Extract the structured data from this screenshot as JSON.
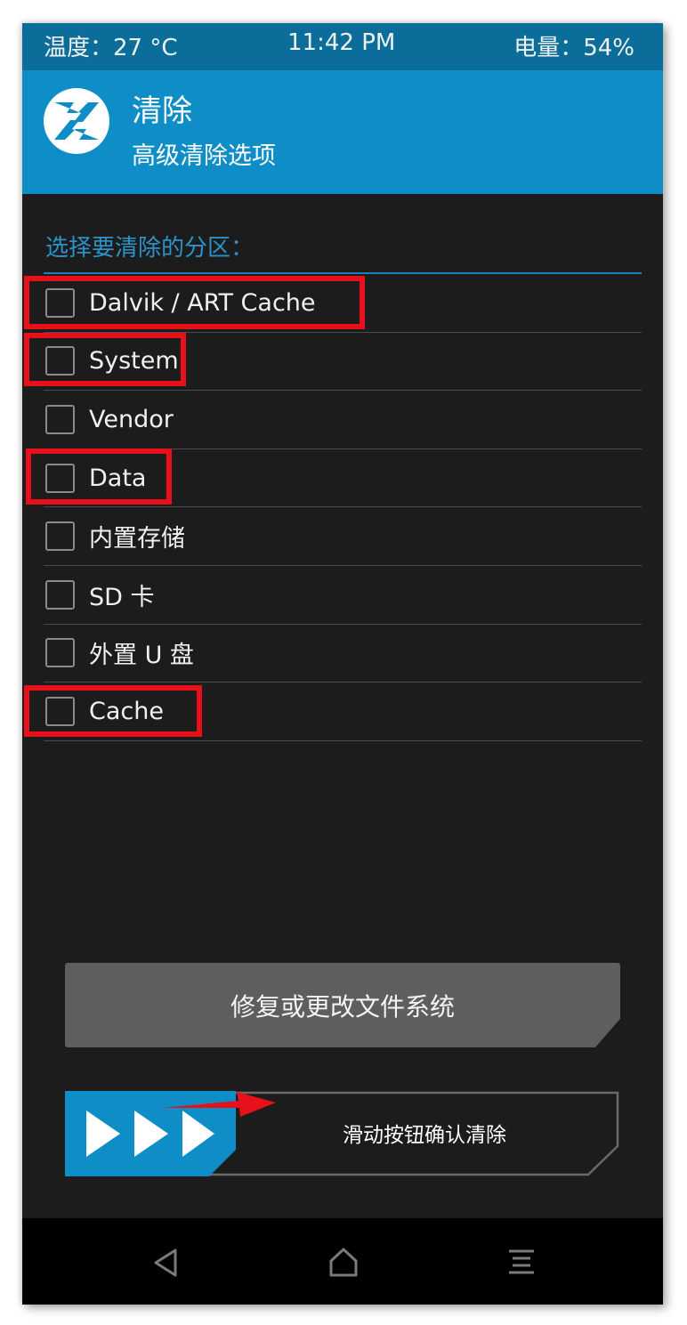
{
  "status_bar": {
    "temperature": "温度：27 °C",
    "time": "11:42 PM",
    "battery": "电量：54%"
  },
  "header": {
    "logo_icon": "twrp-logo-icon",
    "title": "清除",
    "subtitle": "高级清除选项"
  },
  "section": {
    "label": "选择要清除的分区："
  },
  "partitions": [
    {
      "label": "Dalvik / ART Cache",
      "checked": false,
      "highlighted": true
    },
    {
      "label": "System",
      "checked": false,
      "highlighted": true
    },
    {
      "label": "Vendor",
      "checked": false,
      "highlighted": false
    },
    {
      "label": "Data",
      "checked": false,
      "highlighted": true
    },
    {
      "label": "内置存储",
      "checked": false,
      "highlighted": false
    },
    {
      "label": "SD 卡",
      "checked": false,
      "highlighted": false
    },
    {
      "label": "外置 U 盘",
      "checked": false,
      "highlighted": false
    },
    {
      "label": "Cache",
      "checked": false,
      "highlighted": true
    }
  ],
  "repair_button": {
    "label": "修复或更改文件系统"
  },
  "slider": {
    "label": "滑动按钮确认清除",
    "handle_icon": "triple-chevron-right-icon"
  },
  "nav_bar": {
    "back_icon": "back-triangle-icon",
    "home_icon": "home-icon",
    "menu_icon": "menu-lines-icon"
  },
  "colors": {
    "background": "#1c1c1c",
    "status_bar": "#0b6d99",
    "header": "#0e8dc6",
    "accent": "#2a93c9",
    "highlight": "#e8101a",
    "button": "#5e5e5e",
    "slider_handle": "#0e8dc6"
  }
}
